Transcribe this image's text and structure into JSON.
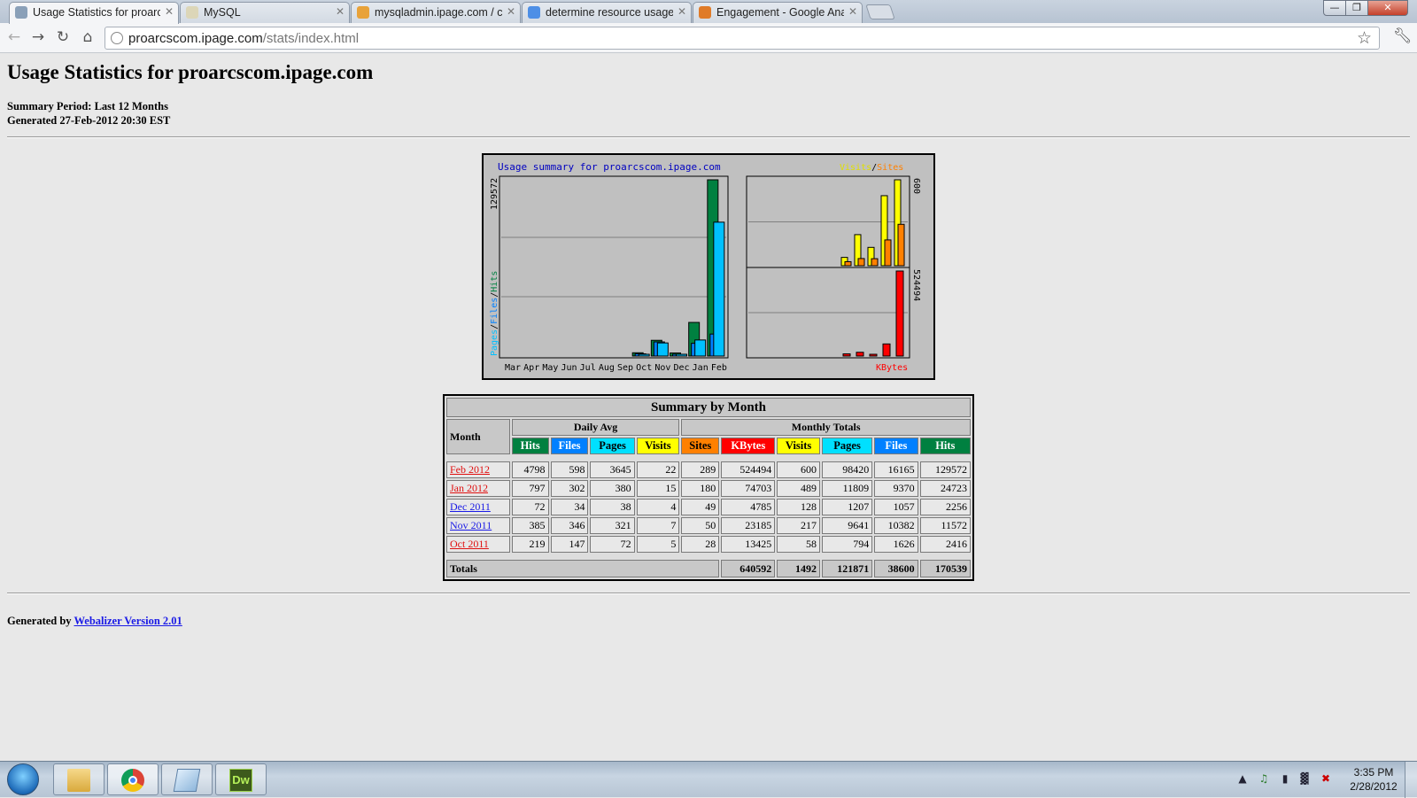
{
  "browser": {
    "tabs": [
      {
        "label": "Usage Statistics for proarcsc",
        "favicon_color": "#8aa0b8"
      },
      {
        "label": "MySQL",
        "favicon_color": "#dcd6b8"
      },
      {
        "label": "mysqladmin.ipage.com / c",
        "favicon_color": "#e8a23a"
      },
      {
        "label": "determine resource usage o",
        "favicon_color": "#4d8fe6"
      },
      {
        "label": "Engagement - Google Anal",
        "favicon_color": "#e07b28"
      }
    ],
    "url_host": "proarcscom.ipage.com",
    "url_path": "/stats/index.html"
  },
  "page": {
    "title": "Usage Statistics for proarcscom.ipage.com",
    "summary_period": "Summary Period: Last 12 Months",
    "generated": "Generated 27-Feb-2012 20:30 EST",
    "generated_by_prefix": "Generated by",
    "generated_by_link": "Webalizer Version 2.01"
  },
  "chart_data": {
    "type": "bar",
    "title": "Usage summary for proarcscom.ipage.com",
    "categories": [
      "Mar",
      "Apr",
      "May",
      "Jun",
      "Jul",
      "Aug",
      "Sep",
      "Oct",
      "Nov",
      "Dec",
      "Jan",
      "Feb"
    ],
    "left_panel": {
      "axis_max": 129572,
      "legend": [
        "Pages",
        "Files",
        "Hits"
      ],
      "series": [
        {
          "name": "Hits",
          "color": "#008040",
          "values": [
            0,
            0,
            0,
            0,
            0,
            0,
            0,
            2416,
            11572,
            2256,
            24723,
            129572
          ]
        },
        {
          "name": "Files",
          "color": "#0080ff",
          "values": [
            0,
            0,
            0,
            0,
            0,
            0,
            0,
            1626,
            10382,
            1057,
            9370,
            16165
          ]
        },
        {
          "name": "Pages",
          "color": "#00c0ff",
          "values": [
            0,
            0,
            0,
            0,
            0,
            0,
            0,
            794,
            9641,
            1207,
            11809,
            98420
          ]
        }
      ]
    },
    "top_right_panel": {
      "axis_max": 600,
      "legend": [
        "Visits",
        "Sites"
      ],
      "series": [
        {
          "name": "Visits",
          "color": "#ffff00",
          "values": [
            0,
            0,
            0,
            0,
            0,
            0,
            0,
            58,
            217,
            128,
            489,
            600
          ]
        },
        {
          "name": "Sites",
          "color": "#ff8000",
          "values": [
            0,
            0,
            0,
            0,
            0,
            0,
            0,
            28,
            50,
            49,
            180,
            289
          ]
        }
      ]
    },
    "bottom_right_panel": {
      "axis_max": 524494,
      "legend": [
        "KBytes"
      ],
      "series": [
        {
          "name": "KBytes",
          "color": "#ff0000",
          "values": [
            0,
            0,
            0,
            0,
            0,
            0,
            0,
            13425,
            23185,
            4785,
            74703,
            524494
          ]
        }
      ]
    }
  },
  "summary_table": {
    "title": "Summary by Month",
    "month_header": "Month",
    "daily_avg_header": "Daily Avg",
    "monthly_totals_header": "Monthly Totals",
    "daily_columns": [
      {
        "label": "Hits",
        "color": "#008040",
        "text": "#ffffff"
      },
      {
        "label": "Files",
        "color": "#0080ff",
        "text": "#ffffff"
      },
      {
        "label": "Pages",
        "color": "#00e0ff",
        "text": "#000000"
      },
      {
        "label": "Visits",
        "color": "#ffff00",
        "text": "#000000"
      }
    ],
    "monthly_columns": [
      {
        "label": "Sites",
        "color": "#ff8000",
        "text": "#000000"
      },
      {
        "label": "KBytes",
        "color": "#ff0000",
        "text": "#ffffff"
      },
      {
        "label": "Visits",
        "color": "#ffff00",
        "text": "#000000"
      },
      {
        "label": "Pages",
        "color": "#00e0ff",
        "text": "#000000"
      },
      {
        "label": "Files",
        "color": "#0080ff",
        "text": "#ffffff"
      },
      {
        "label": "Hits",
        "color": "#008040",
        "text": "#ffffff"
      }
    ],
    "rows": [
      {
        "month": "Feb 2012",
        "link_color": "red",
        "daily": [
          "4798",
          "598",
          "3645",
          "22"
        ],
        "monthly": [
          "289",
          "524494",
          "600",
          "98420",
          "16165",
          "129572"
        ]
      },
      {
        "month": "Jan 2012",
        "link_color": "red",
        "daily": [
          "797",
          "302",
          "380",
          "15"
        ],
        "monthly": [
          "180",
          "74703",
          "489",
          "11809",
          "9370",
          "24723"
        ]
      },
      {
        "month": "Dec 2011",
        "link_color": "blue",
        "daily": [
          "72",
          "34",
          "38",
          "4"
        ],
        "monthly": [
          "49",
          "4785",
          "128",
          "1207",
          "1057",
          "2256"
        ]
      },
      {
        "month": "Nov 2011",
        "link_color": "blue",
        "daily": [
          "385",
          "346",
          "321",
          "7"
        ],
        "monthly": [
          "50",
          "23185",
          "217",
          "9641",
          "10382",
          "11572"
        ]
      },
      {
        "month": "Oct 2011",
        "link_color": "red",
        "daily": [
          "219",
          "147",
          "72",
          "5"
        ],
        "monthly": [
          "28",
          "13425",
          "58",
          "794",
          "1626",
          "2416"
        ]
      }
    ],
    "totals_label": "Totals",
    "totals": [
      "640592",
      "1492",
      "121871",
      "38600",
      "170539"
    ]
  },
  "taskbar": {
    "time": "3:35 PM",
    "date": "2/28/2012"
  }
}
